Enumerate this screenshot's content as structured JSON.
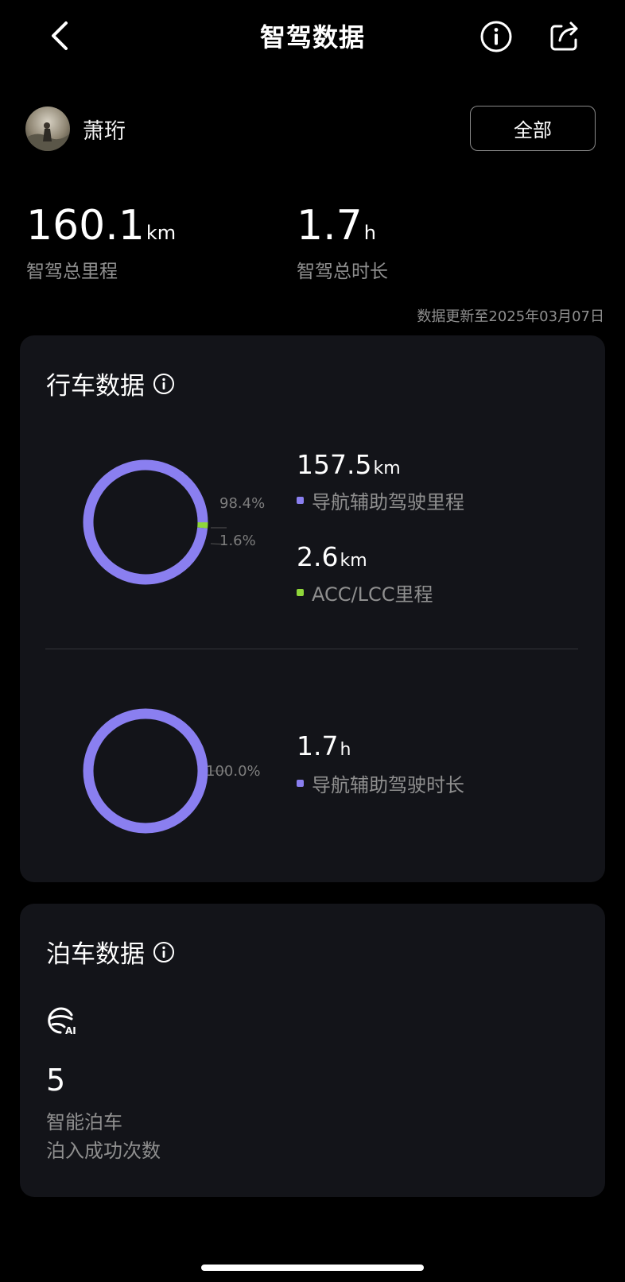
{
  "header": {
    "title": "智驾数据",
    "back_icon": "chevron-left-icon",
    "info_icon": "info-icon",
    "share_icon": "share-icon"
  },
  "user": {
    "name": "萧珩",
    "filter_label": "全部"
  },
  "summary": {
    "total_distance_value": "160.1",
    "total_distance_unit": "km",
    "total_distance_label": "智驾总里程",
    "total_time_value": "1.7",
    "total_time_unit": "h",
    "total_time_label": "智驾总时长",
    "update_note": "数据更新至2025年03月07日"
  },
  "driving": {
    "title": "行车数据",
    "distance_chart": {
      "segments": [
        {
          "name": "导航辅助驾驶里程",
          "percent_label": "98.4%",
          "share": 0.984,
          "color": "#8a7ff0",
          "value": "157.5",
          "unit": "km"
        },
        {
          "name": "ACC/LCC里程",
          "percent_label": "1.6%",
          "share": 0.016,
          "color": "#8fd63a",
          "value": "2.6",
          "unit": "km"
        }
      ]
    },
    "time_chart": {
      "segments": [
        {
          "name": "导航辅助驾驶时长",
          "percent_label": "100.0%",
          "share": 1.0,
          "color": "#8a7ff0",
          "value": "1.7",
          "unit": "h"
        }
      ]
    }
  },
  "parking": {
    "title": "泊车数据",
    "icon": "steering-wheel-ai-icon",
    "count": "5",
    "label_line1": "智能泊车",
    "label_line2": "泊入成功次数"
  }
}
